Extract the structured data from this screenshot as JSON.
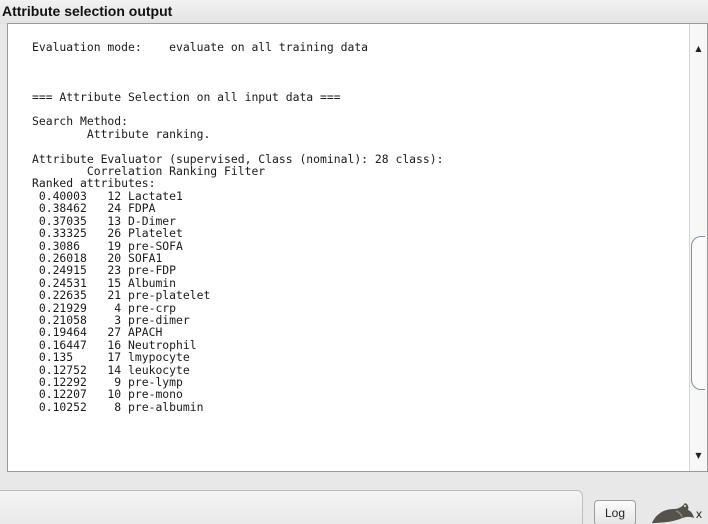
{
  "panel": {
    "title": "Attribute selection output"
  },
  "output": {
    "text": "Evaluation mode:    evaluate on all training data\n\n\n\n=== Attribute Selection on all input data ===\n\nSearch Method:\n        Attribute ranking.\n\nAttribute Evaluator (supervised, Class (nominal): 28 class):\n        Correlation Ranking Filter\nRanked attributes:\n 0.40003   12 Lactate1\n 0.38462   24 FDPA\n 0.37035   13 D-Dimer\n 0.33325   26 Platelet\n 0.3086    19 pre-SOFA\n 0.26018   20 SOFA1\n 0.24915   23 pre-FDP\n 0.24531   15 Albumin\n 0.22635   21 pre-platelet\n 0.21929    4 pre-crp\n 0.21058    3 pre-dimer\n 0.19464   27 APACH\n 0.16447   16 Neutrophil\n 0.135     17 lmypocyte\n 0.12752   14 leukocyte\n 0.12292    9 pre-lymp\n 0.12207   10 pre-mono\n 0.10252    8 pre-albumin"
  },
  "scrollbar": {
    "up_arrow": "▲",
    "down_arrow": "▼"
  },
  "footer": {
    "log_label": "Log",
    "count_label": "x",
    "icon": "weka-bird-icon"
  }
}
